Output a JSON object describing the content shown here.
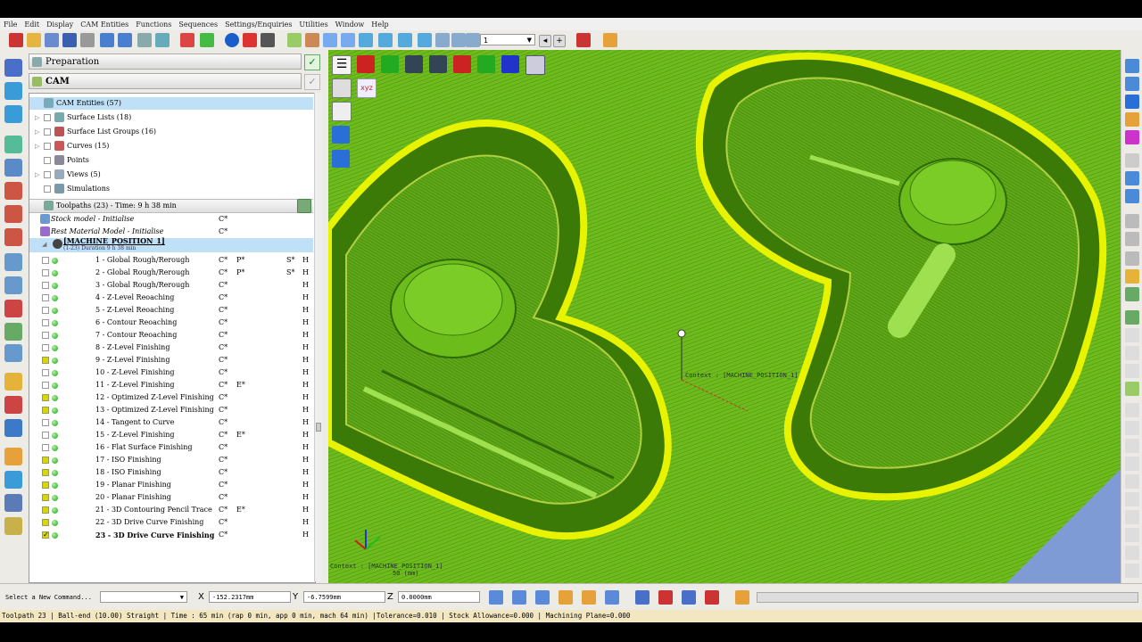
{
  "menu": [
    "File",
    "Edit",
    "Display",
    "CAM Entities",
    "Functions",
    "Sequences",
    "Settings/Enquiries",
    "Utilities",
    "Window",
    "Help"
  ],
  "toolbar": {
    "layer_value": "1"
  },
  "panel": {
    "preparation": "Preparation",
    "cam": "CAM",
    "cam_entities": "CAM Entities (57)",
    "tree_items": [
      {
        "label": "Surface Lists  (18)"
      },
      {
        "label": "Surface List Groups  (16)"
      },
      {
        "label": "Curves  (15)"
      },
      {
        "label": "Points"
      },
      {
        "label": "Views  (5)"
      },
      {
        "label": "Simulations"
      }
    ],
    "toolpaths_header": "Toolpaths (23) - Time: 9 h 38 min",
    "stock_model": "Stock model - Initialise",
    "stock_model_c": "C*",
    "rest_model": "Rest Material Model - Initialise",
    "rest_model_c": "C*",
    "machine_position": "[MACHINE_POSITION_1]",
    "machine_sub": "(1-23) Duration 9 h 38 min",
    "toolpaths": [
      {
        "name": "1 - Global Rough/Rerough",
        "c1": "C*",
        "c2": "P*",
        "c3": "S*",
        "c4": "H",
        "yellow": false
      },
      {
        "name": "2 - Global Rough/Rerough",
        "c1": "C*",
        "c2": "P*",
        "c3": "S*",
        "c4": "H",
        "yellow": false
      },
      {
        "name": "3 - Global Rough/Rerough",
        "c1": "C*",
        "c2": "",
        "c3": "",
        "c4": "H",
        "yellow": false
      },
      {
        "name": "4 - Z-Level Reoaching",
        "c1": "C*",
        "c2": "",
        "c3": "",
        "c4": "H",
        "yellow": false
      },
      {
        "name": "5 - Z-Level Reoaching",
        "c1": "C*",
        "c2": "",
        "c3": "",
        "c4": "H",
        "yellow": false
      },
      {
        "name": "6 - Contour Reoaching",
        "c1": "C*",
        "c2": "",
        "c3": "",
        "c4": "H",
        "yellow": false
      },
      {
        "name": "7 - Contour Reoaching",
        "c1": "C*",
        "c2": "",
        "c3": "",
        "c4": "H",
        "yellow": false
      },
      {
        "name": "8 - Z-Level Finishing",
        "c1": "C*",
        "c2": "",
        "c3": "",
        "c4": "H",
        "yellow": false
      },
      {
        "name": "9 - Z-Level Finishing",
        "c1": "C*",
        "c2": "",
        "c3": "",
        "c4": "H",
        "yellow": true
      },
      {
        "name": "10 - Z-Level Finishing",
        "c1": "C*",
        "c2": "",
        "c3": "",
        "c4": "H",
        "yellow": false
      },
      {
        "name": "11 - Z-Level Finishing",
        "c1": "C*",
        "c2": "E*",
        "c3": "",
        "c4": "H",
        "yellow": false
      },
      {
        "name": "12 - Optimized Z-Level Finishing",
        "c1": "C*",
        "c2": "",
        "c3": "",
        "c4": "H",
        "yellow": true
      },
      {
        "name": "13 - Optimized Z-Level Finishing",
        "c1": "C*",
        "c2": "",
        "c3": "",
        "c4": "H",
        "yellow": true
      },
      {
        "name": "14 - Tangent to Curve",
        "c1": "C*",
        "c2": "",
        "c3": "",
        "c4": "H",
        "yellow": false
      },
      {
        "name": "15 - Z-Level Finishing",
        "c1": "C*",
        "c2": "E*",
        "c3": "",
        "c4": "H",
        "yellow": false
      },
      {
        "name": "16 - Flat Surface Finishing",
        "c1": "C*",
        "c2": "",
        "c3": "",
        "c4": "H",
        "yellow": false
      },
      {
        "name": "17 - ISO Finishing",
        "c1": "C*",
        "c2": "",
        "c3": "",
        "c4": "H",
        "yellow": true
      },
      {
        "name": "18 - ISO Finishing",
        "c1": "C*",
        "c2": "",
        "c3": "",
        "c4": "H",
        "yellow": true
      },
      {
        "name": "19 - Planar Finishing",
        "c1": "C*",
        "c2": "",
        "c3": "",
        "c4": "H",
        "yellow": true
      },
      {
        "name": "20 - Planar Finishing",
        "c1": "C*",
        "c2": "",
        "c3": "",
        "c4": "H",
        "yellow": true
      },
      {
        "name": "21 - 3D Contouring Pencil Trace",
        "c1": "C*",
        "c2": "E*",
        "c3": "",
        "c4": "H",
        "yellow": true
      },
      {
        "name": "22 - 3D Drive Curve Finishing",
        "c1": "C*",
        "c2": "",
        "c3": "",
        "c4": "H",
        "yellow": true
      },
      {
        "name": "23 - 3D Drive Curve Finishing",
        "c1": "C*",
        "c2": "",
        "c3": "",
        "c4": "H",
        "yellow": true,
        "checked": true
      }
    ]
  },
  "viewport": {
    "context_label": "Context : [MACHINE_POSITION_1]",
    "corner_context": "Context : [MACHINE_POSITION_1]",
    "scale": "50 (mm)"
  },
  "command": {
    "prompt": "Select a New Command...",
    "x_label": "X",
    "x_value": "-152.2317mm",
    "y_label": "Y",
    "y_value": "-6.7599mm",
    "z_label": "Z",
    "z_value": "0.0000mm"
  },
  "status": "Toolpath 23 | Ball-end (10.00) Straight | Time : 65 min (rap 0 min, app 0 min, mach 64 min) |Tolerance=0.010 | Stock Allowance=0.000 | Machining Plane=0.000",
  "colors": {
    "part_green": "#6fbb1e",
    "toolpath_yellow": "#ffff00",
    "selection": "#bfe0f6",
    "status_bg": "#f3e7c2"
  }
}
